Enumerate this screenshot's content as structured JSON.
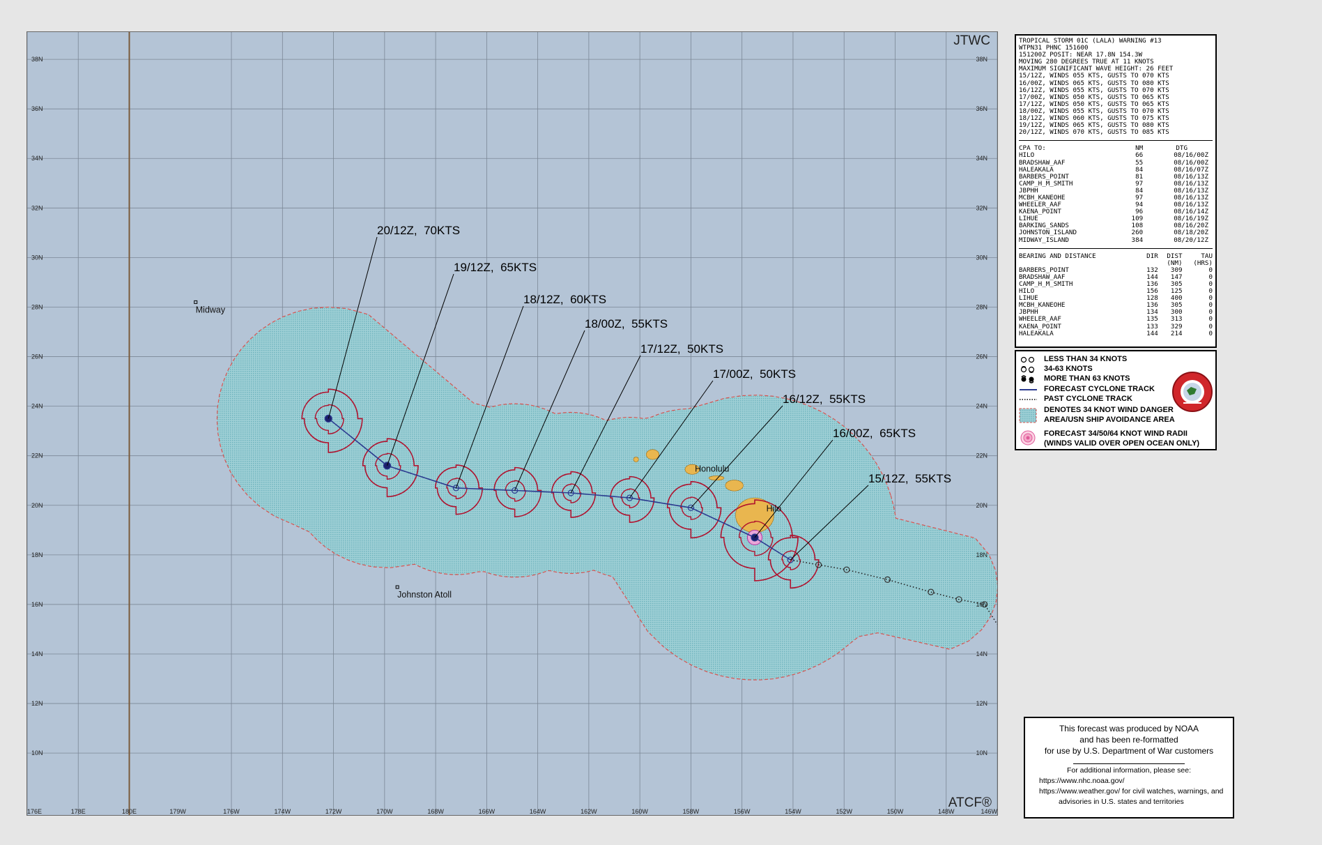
{
  "map": {
    "agency_label": "JTWC",
    "system_label": "ATCF®",
    "lat_labels": [
      "38N",
      "36N",
      "34N",
      "32N",
      "30N",
      "28N",
      "26N",
      "24N",
      "22N",
      "20N",
      "18N",
      "16N",
      "14N",
      "12N",
      "10N"
    ],
    "lon_labels": [
      "176E",
      "178E",
      "180E",
      "179W",
      "176W",
      "174W",
      "172W",
      "170W",
      "168W",
      "166W",
      "164W",
      "162W",
      "160W",
      "158W",
      "156W",
      "154W",
      "152W",
      "150W",
      "148W",
      "146W"
    ],
    "places": [
      {
        "name": "Midway",
        "lon": -177.4,
        "lat": 28.2
      },
      {
        "name": "Johnston Atoll",
        "lon": -169.5,
        "lat": 16.7
      },
      {
        "name": "Honolulu",
        "lon": -157.9,
        "lat": 21.3
      },
      {
        "name": "Hilo",
        "lon": -155.1,
        "lat": 19.7
      }
    ],
    "forecast_points": [
      {
        "label": "15/12Z,  55KTS",
        "lon": -154.1,
        "lat": 17.8,
        "r34": 3.0,
        "r50": 1.1
      },
      {
        "label": "16/00Z,  65KTS",
        "lon": -155.5,
        "lat": 18.7,
        "r34": 4.6,
        "r50": 2.0,
        "r64": 0.9
      },
      {
        "label": "16/12Z,  55KTS",
        "lon": -158.0,
        "lat": 19.9,
        "r34": 3.2,
        "r50": 1.3
      },
      {
        "label": "17/00Z,  50KTS",
        "lon": -160.4,
        "lat": 20.3,
        "r34": 2.6,
        "r50": 1.1
      },
      {
        "label": "17/12Z,  50KTS",
        "lon": -162.7,
        "lat": 20.5,
        "r34": 2.6,
        "r50": 1.1
      },
      {
        "label": "18/00Z,  55KTS",
        "lon": -164.9,
        "lat": 20.6,
        "r34": 2.8,
        "r50": 1.2
      },
      {
        "label": "18/12Z,  60KTS",
        "lon": -167.2,
        "lat": 20.7,
        "r34": 2.8,
        "r50": 1.2
      },
      {
        "label": "19/12Z,  65KTS",
        "lon": -169.9,
        "lat": 21.6,
        "r34": 3.3,
        "r50": 1.5
      },
      {
        "label": "20/12Z,  70KTS",
        "lon": -172.2,
        "lat": 23.5,
        "r34": 3.6,
        "r50": 1.7
      }
    ],
    "past_track": [
      {
        "lon": -153.0,
        "lat": 17.6
      },
      {
        "lon": -151.9,
        "lat": 17.4
      },
      {
        "lon": -150.3,
        "lat": 17.0
      },
      {
        "lon": -148.6,
        "lat": 16.5
      },
      {
        "lon": -147.5,
        "lat": 16.2
      },
      {
        "lon": -146.5,
        "lat": 16.0
      }
    ],
    "colors": {
      "ocean": "#b4c4d6",
      "danger_area": "#8ec6cf",
      "danger_border": "#d9534f",
      "wind_radii": "#b0112d",
      "track": "#2b3a8f",
      "land": "#e9b64f",
      "dateline": "#7a5a3a"
    }
  },
  "warning": {
    "header": [
      "TROPICAL STORM 01C (LALA) WARNING #13",
      "WTPN31 PHNC 151600",
      "151200Z POSIT: NEAR 17.8N 154.3W",
      "MOVING 280 DEGREES TRUE AT 11 KNOTS",
      "MAXIMUM SIGNIFICANT WAVE HEIGHT: 26 FEET",
      "15/12Z, WINDS 055 KTS, GUSTS TO 070 KTS",
      "16/00Z, WINDS 065 KTS, GUSTS TO 080 KTS",
      "16/12Z, WINDS 055 KTS, GUSTS TO 070 KTS",
      "17/00Z, WINDS 050 KTS, GUSTS TO 065 KTS",
      "17/12Z, WINDS 050 KTS, GUSTS TO 065 KTS",
      "18/00Z, WINDS 055 KTS, GUSTS TO 070 KTS",
      "18/12Z, WINDS 060 KTS, GUSTS TO 075 KTS",
      "19/12Z, WINDS 065 KTS, GUSTS TO 080 KTS",
      "20/12Z, WINDS 070 KTS, GUSTS TO 085 KTS"
    ],
    "cpa_headers": [
      "CPA TO:",
      "NM",
      "DTG"
    ],
    "cpa": [
      [
        "HILO",
        "66",
        "08/16/00Z"
      ],
      [
        "BRADSHAW_AAF",
        "55",
        "08/16/00Z"
      ],
      [
        "HALEAKALA",
        "84",
        "08/16/07Z"
      ],
      [
        "BARBERS_POINT",
        "81",
        "08/16/13Z"
      ],
      [
        "CAMP_H_M_SMITH",
        "97",
        "08/16/13Z"
      ],
      [
        "JBPHH",
        "84",
        "08/16/13Z"
      ],
      [
        "MCBH_KANEOHE",
        "97",
        "08/16/13Z"
      ],
      [
        "WHEELER_AAF",
        "94",
        "08/16/13Z"
      ],
      [
        "KAENA_POINT",
        "96",
        "08/16/14Z"
      ],
      [
        "LIHUE",
        "109",
        "08/16/19Z"
      ],
      [
        "BARKING_SANDS",
        "108",
        "08/16/20Z"
      ],
      [
        "JOHNSTON_ISLAND",
        "260",
        "08/18/20Z"
      ],
      [
        "MIDWAY_ISLAND",
        "384",
        "08/20/12Z"
      ]
    ],
    "bd_headers": [
      "BEARING AND DISTANCE",
      "DIR",
      "DIST",
      "TAU"
    ],
    "bd_units": [
      "",
      "",
      "(NM)",
      "(HRS)"
    ],
    "bd": [
      [
        "BARBERS_POINT",
        "132",
        "309",
        "0"
      ],
      [
        "BRADSHAW_AAF",
        "144",
        "147",
        "0"
      ],
      [
        "CAMP_H_M_SMITH",
        "136",
        "305",
        "0"
      ],
      [
        "HILO",
        "156",
        "125",
        "0"
      ],
      [
        "LIHUE",
        "128",
        "400",
        "0"
      ],
      [
        "MCBH_KANEOHE",
        "136",
        "305",
        "0"
      ],
      [
        "JBPHH",
        "134",
        "300",
        "0"
      ],
      [
        "WHEELER_AAF",
        "135",
        "313",
        "0"
      ],
      [
        "KAENA_POINT",
        "133",
        "329",
        "0"
      ],
      [
        "HALEAKALA",
        "144",
        "214",
        "0"
      ]
    ]
  },
  "legend": {
    "items": [
      "LESS THAN 34 KNOTS",
      "34-63 KNOTS",
      "MORE THAN 63 KNOTS",
      "FORECAST CYCLONE TRACK",
      "PAST CYCLONE TRACK",
      "DENOTES 34 KNOT WIND DANGER",
      "AREA/USN SHIP AVOIDANCE AREA",
      "FORECAST 34/50/64 KNOT WIND RADII",
      "(WINDS VALID OVER OPEN OCEAN ONLY)"
    ]
  },
  "notice": {
    "line1": "This forecast was produced by NOAA",
    "line2": "and has been re-formatted",
    "line3": "for use by U.S. Department of War customers",
    "info": "For additional information, please see:",
    "url1": "https://www.nhc.noaa.gov/",
    "url2": "https://www.weather.gov/ for civil watches, warnings, and",
    "url2b": "advisories in U.S. states and territories"
  }
}
